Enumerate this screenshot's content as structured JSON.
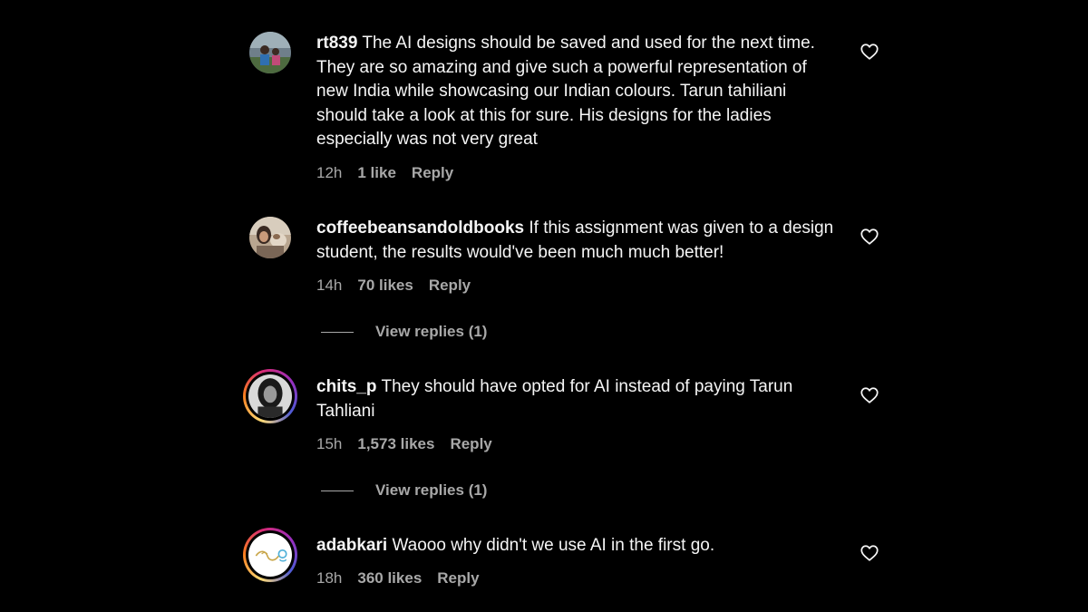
{
  "comments": [
    {
      "username": "rt839",
      "text": "The AI designs should be saved and used for the next time. They are so amazing and give such a powerful representation of new India while showcasing our Indian colours. Tarun tahiliani should take a look at this for sure. His designs for the ladies especially was not very great",
      "time": "12h",
      "likes": "1 like",
      "reply_label": "Reply",
      "like_icon": "heart-outline-icon",
      "avatar_story_ring": false
    },
    {
      "username": "coffeebeansandoldbooks",
      "text": "If this assignment was given to a design student, the results would've been much much better!",
      "time": "14h",
      "likes": "70 likes",
      "reply_label": "Reply",
      "view_replies": "View replies (1)",
      "like_icon": "heart-outline-icon",
      "avatar_story_ring": false
    },
    {
      "username": "chits_p",
      "text": "They should have opted for AI instead of paying Tarun Tahliani",
      "time": "15h",
      "likes": "1,573 likes",
      "reply_label": "Reply",
      "view_replies": "View replies (1)",
      "like_icon": "heart-outline-icon",
      "avatar_story_ring": true
    },
    {
      "username": "adabkari",
      "text": "Waooo why didn't we use AI in the first go.",
      "time": "18h",
      "likes": "360 likes",
      "reply_label": "Reply",
      "like_icon": "heart-outline-icon",
      "avatar_story_ring": true
    }
  ],
  "colors": {
    "background": "#000000",
    "primary_text": "#f5f5f5",
    "secondary_text": "#a8a8a8",
    "story_ring": [
      "#feda75",
      "#fa7e1e",
      "#d62976",
      "#962fbf",
      "#4f5bd5"
    ]
  }
}
